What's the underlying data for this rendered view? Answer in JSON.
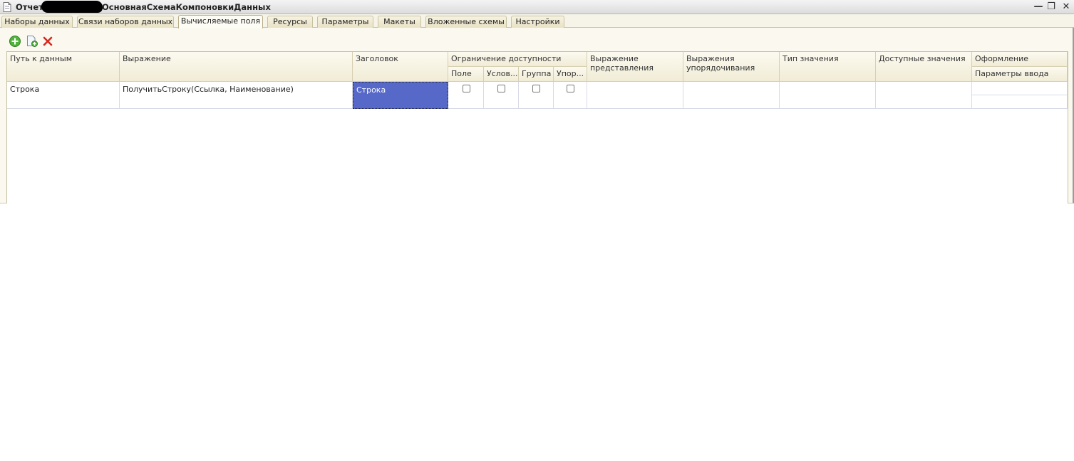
{
  "window": {
    "title_prefix": "Отчет",
    "title_main": "ОсновнаяСхемаКомпоновкиДанных",
    "minimize_glyph": "—",
    "restore_glyph": "❐",
    "close_glyph": "✕"
  },
  "tabs": [
    {
      "label": "Наборы данных",
      "active": false
    },
    {
      "label": "Связи наборов данных",
      "active": false
    },
    {
      "label": "Вычисляемые поля",
      "active": true
    },
    {
      "label": "Ресурсы",
      "active": false
    },
    {
      "label": "Параметры",
      "active": false
    },
    {
      "label": "Макеты",
      "active": false
    },
    {
      "label": "Вложенные схемы",
      "active": false
    },
    {
      "label": "Настройки",
      "active": false
    }
  ],
  "toolbar": {
    "add_icon": "add-circle-icon",
    "copy_icon": "copy-icon",
    "delete_icon": "delete-x-icon"
  },
  "table": {
    "headers": {
      "path": "Путь к данным",
      "expression": "Выражение",
      "title": "Заголовок",
      "restriction": "Ограничение доступности",
      "restriction_field": "Поле",
      "restriction_condition": "Услов...",
      "restriction_group": "Группа",
      "restriction_order": "Упор...",
      "presentation_expression": "Выражение представления",
      "order_expression": "Выражения упорядочивания",
      "value_type": "Тип значения",
      "available_values": "Доступные значения",
      "appearance": "Оформление",
      "input_params": "Параметры ввода"
    },
    "rows": [
      {
        "path": "Строка",
        "expression": "ПолучитьСтроку(Ссылка, Наименование)",
        "title": "Строка",
        "restriction_field": false,
        "restriction_condition": false,
        "restriction_group": false,
        "restriction_order": false,
        "presentation_expression": "",
        "order_expression": "",
        "value_type": "",
        "available_values": "",
        "appearance": "",
        "input_params": ""
      }
    ]
  },
  "colors": {
    "selection": "#5668c8",
    "header_bg": "#f1ecd6",
    "window_bg": "#fbf9ef"
  }
}
